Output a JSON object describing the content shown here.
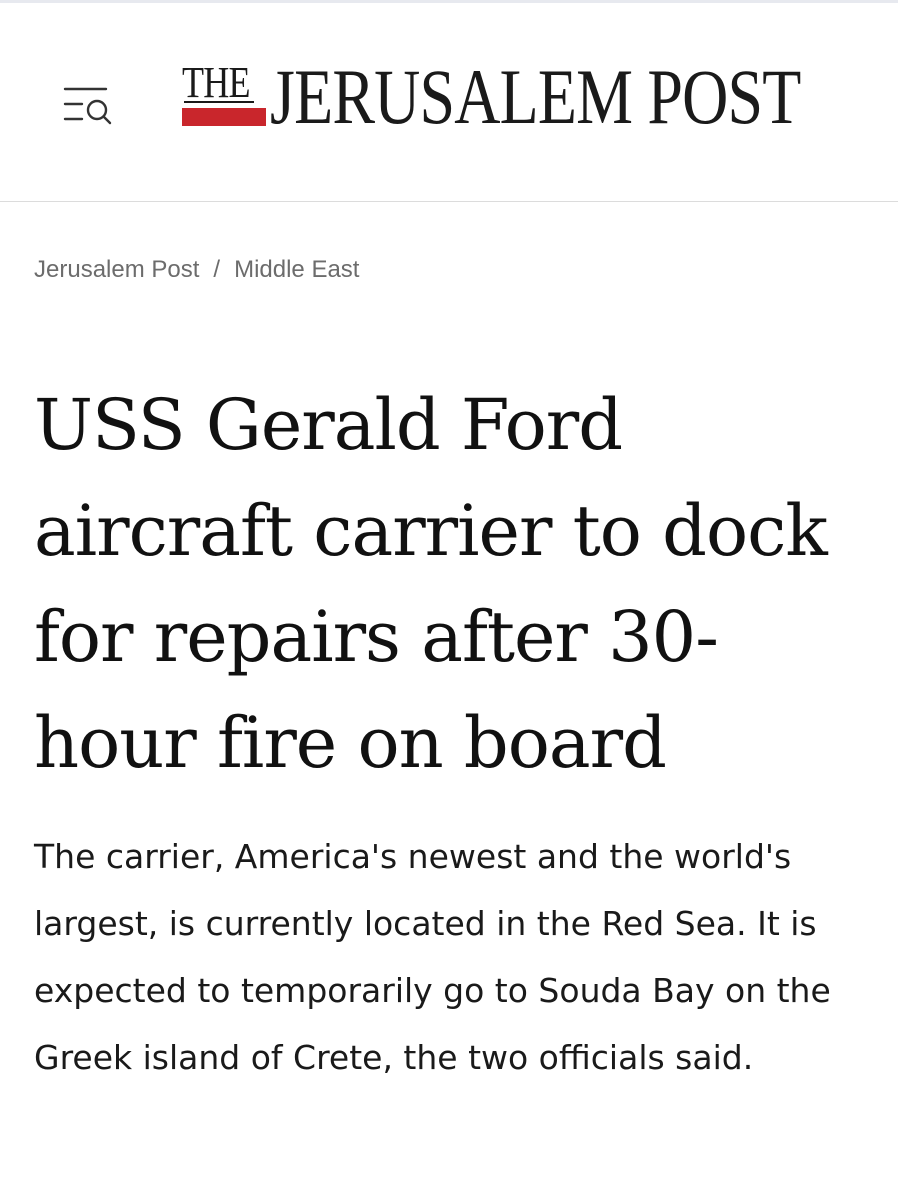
{
  "header": {
    "menu_icon": "menu-search-icon",
    "logo": {
      "the": "THE",
      "name": "JERUSALEM POST",
      "accent_color": "#c9262c"
    }
  },
  "breadcrumb": {
    "items": [
      {
        "label": "Jerusalem Post"
      },
      {
        "label": "Middle East"
      }
    ],
    "separator": "/"
  },
  "article": {
    "headline": "USS Gerald Ford aircraft carrier to dock for repairs after 30-hour fire on board",
    "summary": "The carrier, America's newest and the world's largest, is currently located in the Red Sea. It is expected to temporarily go to Souda Bay on the Greek island of Crete, the two officials said."
  }
}
